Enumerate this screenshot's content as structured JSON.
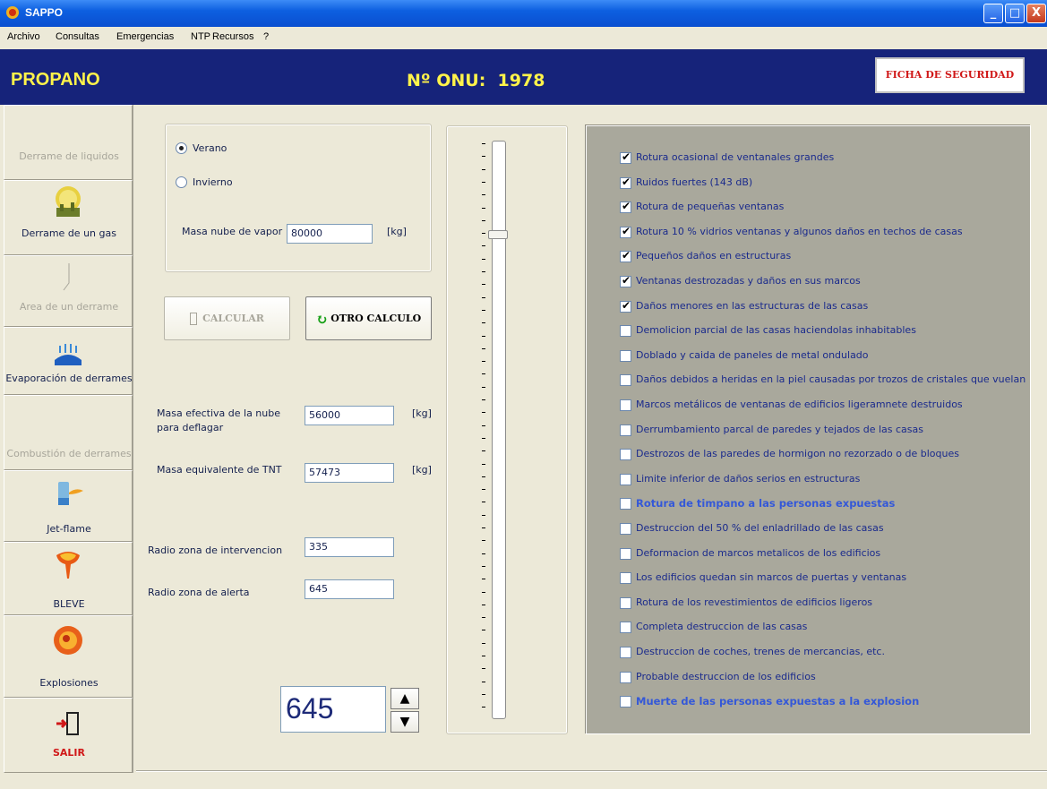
{
  "window": {
    "title": "SAPPO",
    "controls": {
      "minimize": "_",
      "maximize": "□",
      "close": "X"
    }
  },
  "menu": [
    "Archivo",
    "Consultas",
    "Emergencias",
    "NTP",
    "Recursos",
    "?"
  ],
  "header": {
    "substance": "PROPANO",
    "onu_label": "Nº ONU:",
    "onu_value": "1978",
    "safety_button": "FICHA DE SEGURIDAD"
  },
  "nav": [
    {
      "label": "Derrame de liquidos",
      "enabled": false
    },
    {
      "label": "Derrame de un gas",
      "enabled": true,
      "icon": "gas-cloud-icon"
    },
    {
      "label": "Area de un derrame",
      "enabled": false,
      "icon": "spill-area-icon"
    },
    {
      "label": "Evaporación de derrames",
      "enabled": true,
      "icon": "evaporation-icon"
    },
    {
      "label": "Combustión de derrames",
      "enabled": false
    },
    {
      "label": "Jet-flame",
      "enabled": true,
      "icon": "jet-flame-icon"
    },
    {
      "label": "BLEVE",
      "enabled": true,
      "icon": "bleve-icon"
    },
    {
      "label": "Explosiones",
      "enabled": true,
      "icon": "explosion-icon"
    },
    {
      "label": "SALIR",
      "enabled": true,
      "icon": "exit-door-icon"
    }
  ],
  "season": {
    "options": [
      "Verano",
      "Invierno"
    ],
    "selected": "Verano"
  },
  "vapor_mass": {
    "label": "Masa nube de vapor",
    "value": "80000",
    "unit": "[kg]"
  },
  "buttons": {
    "calculate": "CALCULAR",
    "other": "OTRO CALCULO"
  },
  "effective_mass": {
    "label_line1": "Masa efectiva de la nube",
    "label_line2": "para deflagar",
    "value": "56000",
    "unit": "[kg]"
  },
  "tnt_mass": {
    "label": "Masa equivalente de TNT",
    "value": "57473",
    "unit": "[kg]"
  },
  "intervention_radius": {
    "label": "Radio zona de  intervencion",
    "value": "335"
  },
  "alert_radius": {
    "label": "Radio zona de  alerta",
    "value": "645"
  },
  "distance_spinner": {
    "value": "645"
  },
  "slider_level": 0.17,
  "effects": [
    {
      "text": "Rotura ocasional de ventanales grandes",
      "checked": true,
      "bold": false
    },
    {
      "text": "Ruidos fuertes (143 dB)",
      "checked": true,
      "bold": false
    },
    {
      "text": "Rotura de pequeñas ventanas",
      "checked": true,
      "bold": false
    },
    {
      "text": "Rotura 10 % vidrios ventanas y algunos daños en techos de casas",
      "checked": true,
      "bold": false
    },
    {
      "text": "Pequeños daños en estructuras",
      "checked": true,
      "bold": false
    },
    {
      "text": "Ventanas destrozadas y daños en sus marcos",
      "checked": true,
      "bold": false
    },
    {
      "text": "Daños menores en las estructuras de las casas",
      "checked": true,
      "bold": false
    },
    {
      "text": "Demolicion parcial de las casas haciendolas inhabitables",
      "checked": false,
      "bold": false
    },
    {
      "text": "Doblado y caida de paneles de metal ondulado",
      "checked": false,
      "bold": false
    },
    {
      "text": "Daños debidos a heridas en la piel causadas por trozos de cristales que vuelan",
      "checked": false,
      "bold": false
    },
    {
      "text": "Marcos metálicos de ventanas de edificios ligeramnete destruidos",
      "checked": false,
      "bold": false
    },
    {
      "text": "Derrumbamiento parcal de paredes y tejados de las casas",
      "checked": false,
      "bold": false
    },
    {
      "text": "Destrozos de las paredes de hormigon no rezorzado o de bloques",
      "checked": false,
      "bold": false
    },
    {
      "text": "Limite inferior de daños serios en estructuras",
      "checked": false,
      "bold": false
    },
    {
      "text": "Rotura de timpano a las personas expuestas",
      "checked": false,
      "bold": true
    },
    {
      "text": "Destruccion del 50 % del enladrillado de las casas",
      "checked": false,
      "bold": false
    },
    {
      "text": "Deformacion de marcos metalicos de los edificios",
      "checked": false,
      "bold": false
    },
    {
      "text": "Los edificios quedan sin marcos de puertas y ventanas",
      "checked": false,
      "bold": false
    },
    {
      "text": "Rotura de los revestimientos de edificios ligeros",
      "checked": false,
      "bold": false
    },
    {
      "text": "Completa destruccion de las casas",
      "checked": false,
      "bold": false
    },
    {
      "text": "Destruccion de coches, trenes de mercancias, etc.",
      "checked": false,
      "bold": false
    },
    {
      "text": "Probable destruccion de los edificios",
      "checked": false,
      "bold": false
    },
    {
      "text": "Muerte de las personas expuestas a la explosion",
      "checked": false,
      "bold": true
    }
  ]
}
